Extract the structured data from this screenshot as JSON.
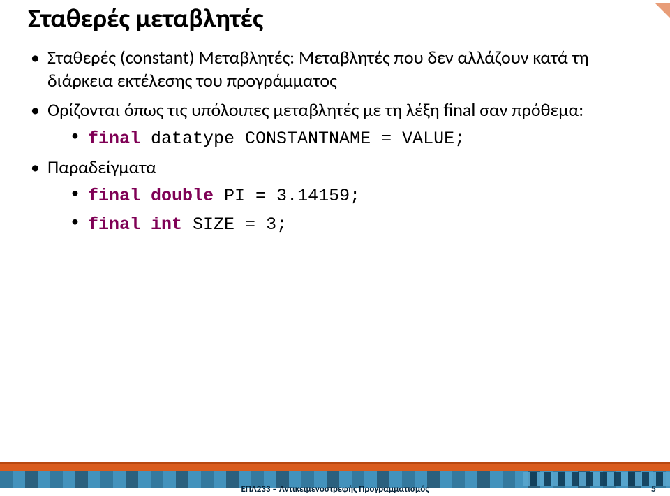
{
  "title": "Σταθερές μεταβλητές",
  "bullets": [
    {
      "text": "Σταθερές (constant) Μεταβλητές: Μεταβλητές που δεν αλλάζουν κατά τη διάρκεια εκτέλεσης του προγράμματος"
    },
    {
      "text": "Ορίζονται όπως τις υπόλοιπες μεταβλητές με τη λέξη final σαν πρόθεμα:",
      "sub": [
        {
          "kw": "final",
          "rest": " datatype CONSTANTNAME = VALUE;"
        }
      ]
    },
    {
      "text": "Παραδείγματα",
      "sub": [
        {
          "kw1": "final",
          "kw2": "double",
          "rest": " PI = 3.14159;"
        },
        {
          "kw1": "final",
          "kw2": "int",
          "rest": " SIZE = 3;"
        }
      ]
    }
  ],
  "footer": {
    "course": "ΕΠΛ233 – Αντικειμενοστρεφής Προγραμματισμός",
    "page": "5"
  }
}
